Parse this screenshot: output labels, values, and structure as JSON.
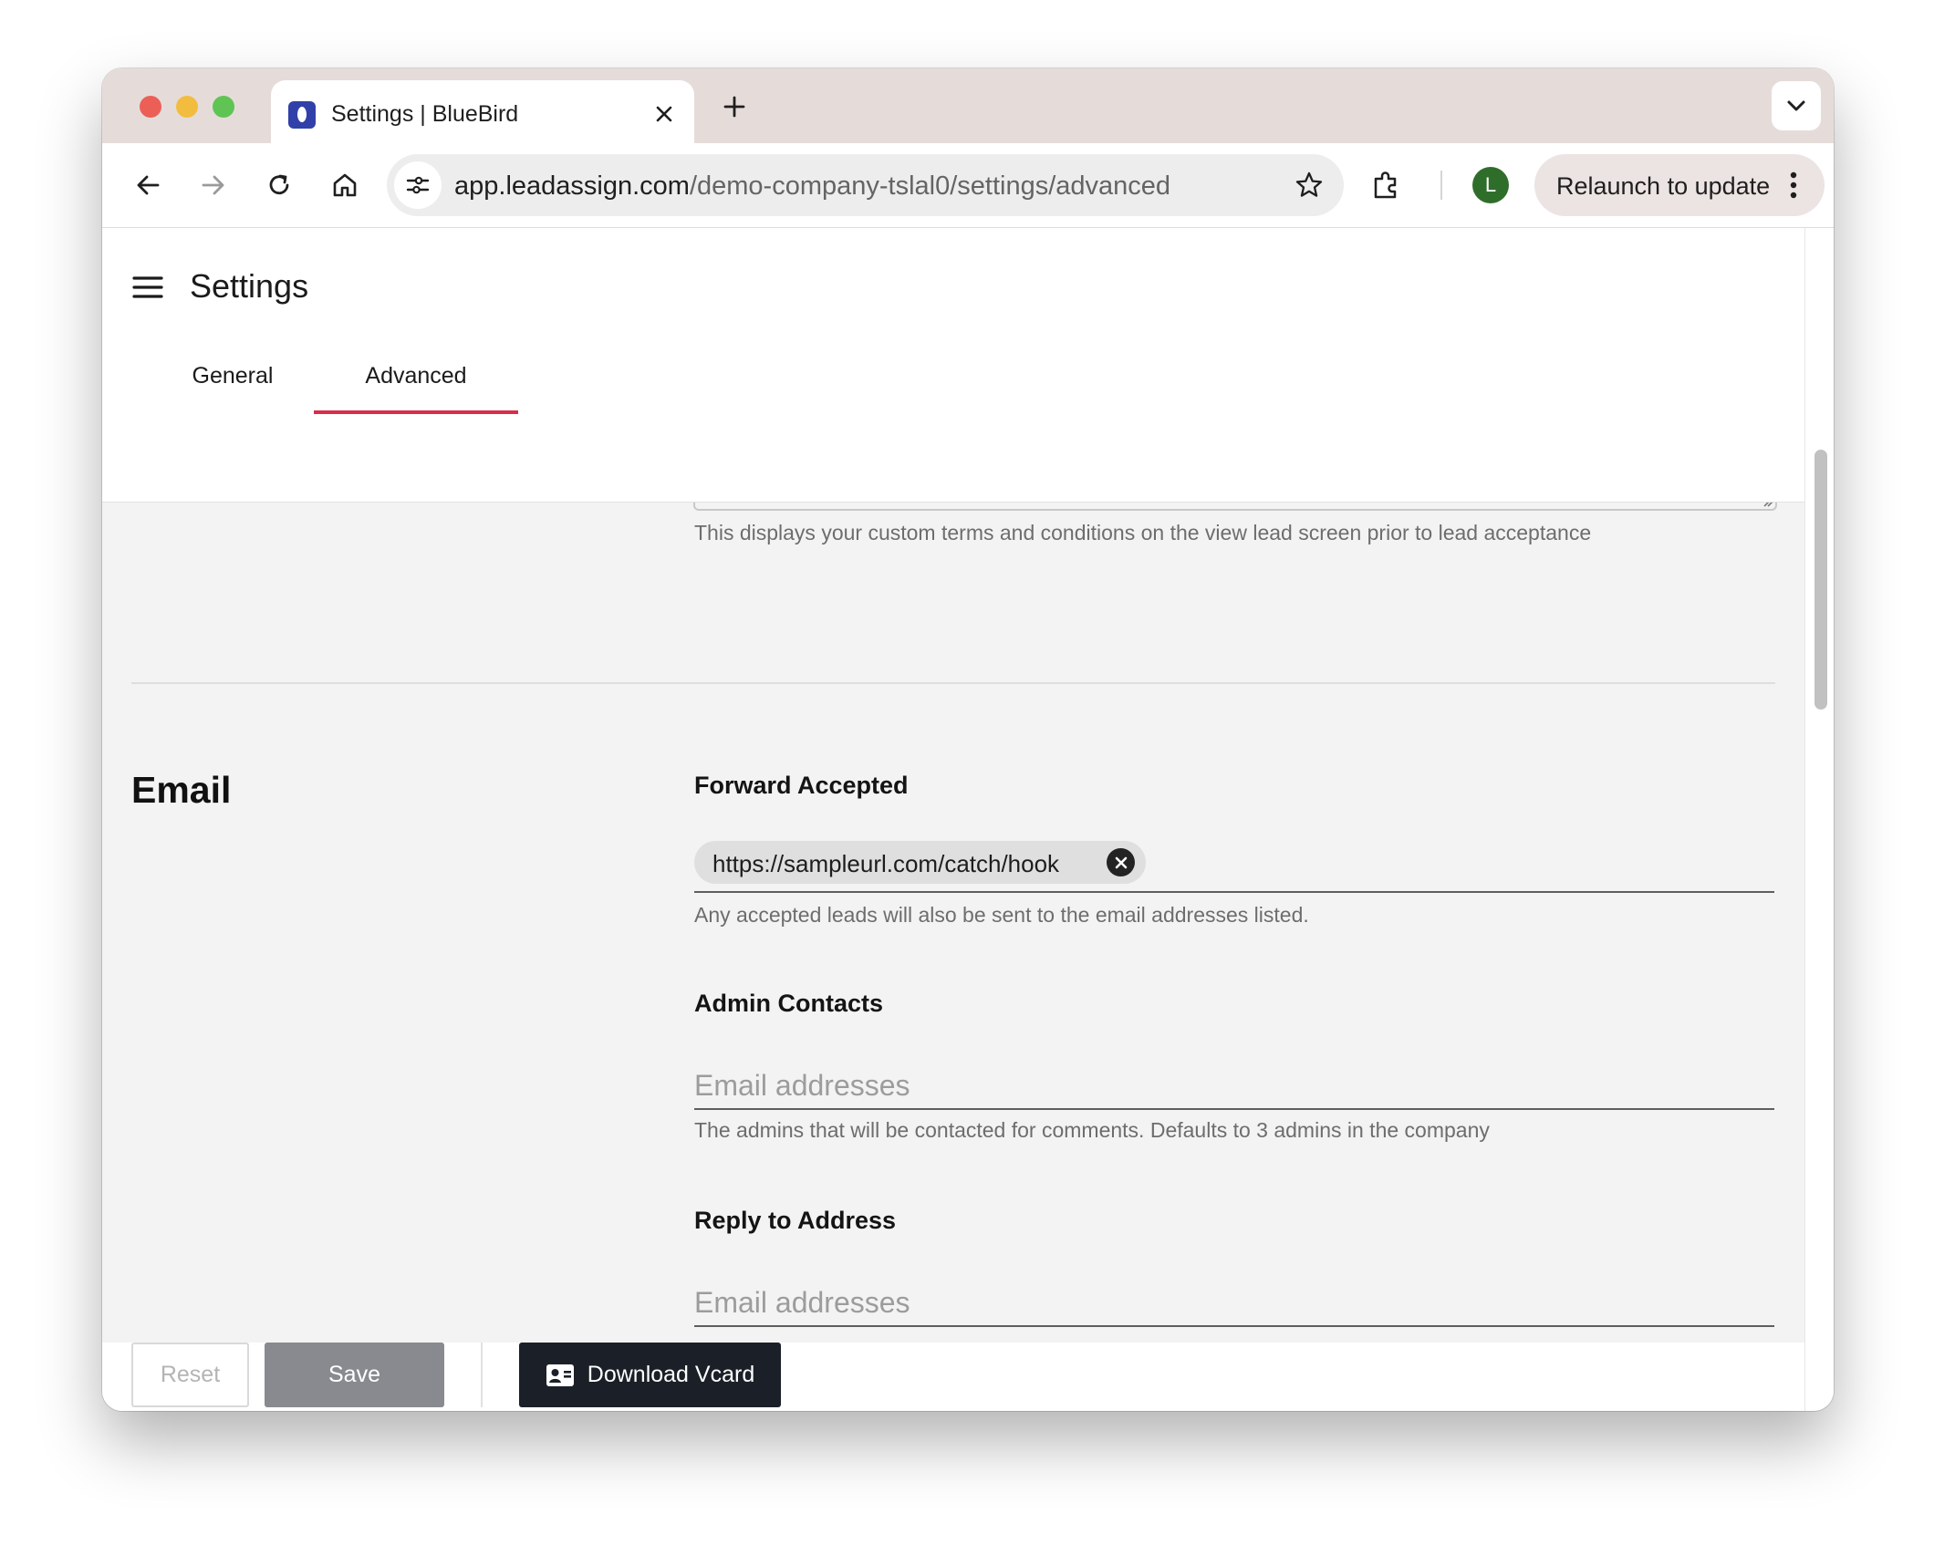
{
  "browser": {
    "tab_title": "Settings | BlueBird",
    "url_host": "app.leadassign.com",
    "url_path": "/demo-company-tslal0/settings/advanced",
    "profile_initial": "L",
    "relaunch_label": "Relaunch to update"
  },
  "app": {
    "page_title": "Settings",
    "tabs": [
      {
        "label": "General",
        "active": false
      },
      {
        "label": "Advanced",
        "active": true
      }
    ],
    "accent_color": "#d92e4a"
  },
  "terms": {
    "helper": "This displays your custom terms and conditions on the view lead screen prior to lead acceptance"
  },
  "email": {
    "section_title": "Email",
    "forward_accepted": {
      "label": "Forward Accepted",
      "chip": "https://sampleurl.com/catch/hook",
      "helper": "Any accepted leads will also be sent to the email addresses listed."
    },
    "admin_contacts": {
      "label": "Admin Contacts",
      "placeholder": "Email addresses",
      "helper": "The admins that will be contacted for comments. Defaults to 3 admins in the company"
    },
    "reply_to": {
      "label": "Reply to Address",
      "placeholder": "Email addresses"
    }
  },
  "footer": {
    "reset_label": "Reset",
    "save_label": "Save",
    "vcard_label": "Download Vcard"
  }
}
